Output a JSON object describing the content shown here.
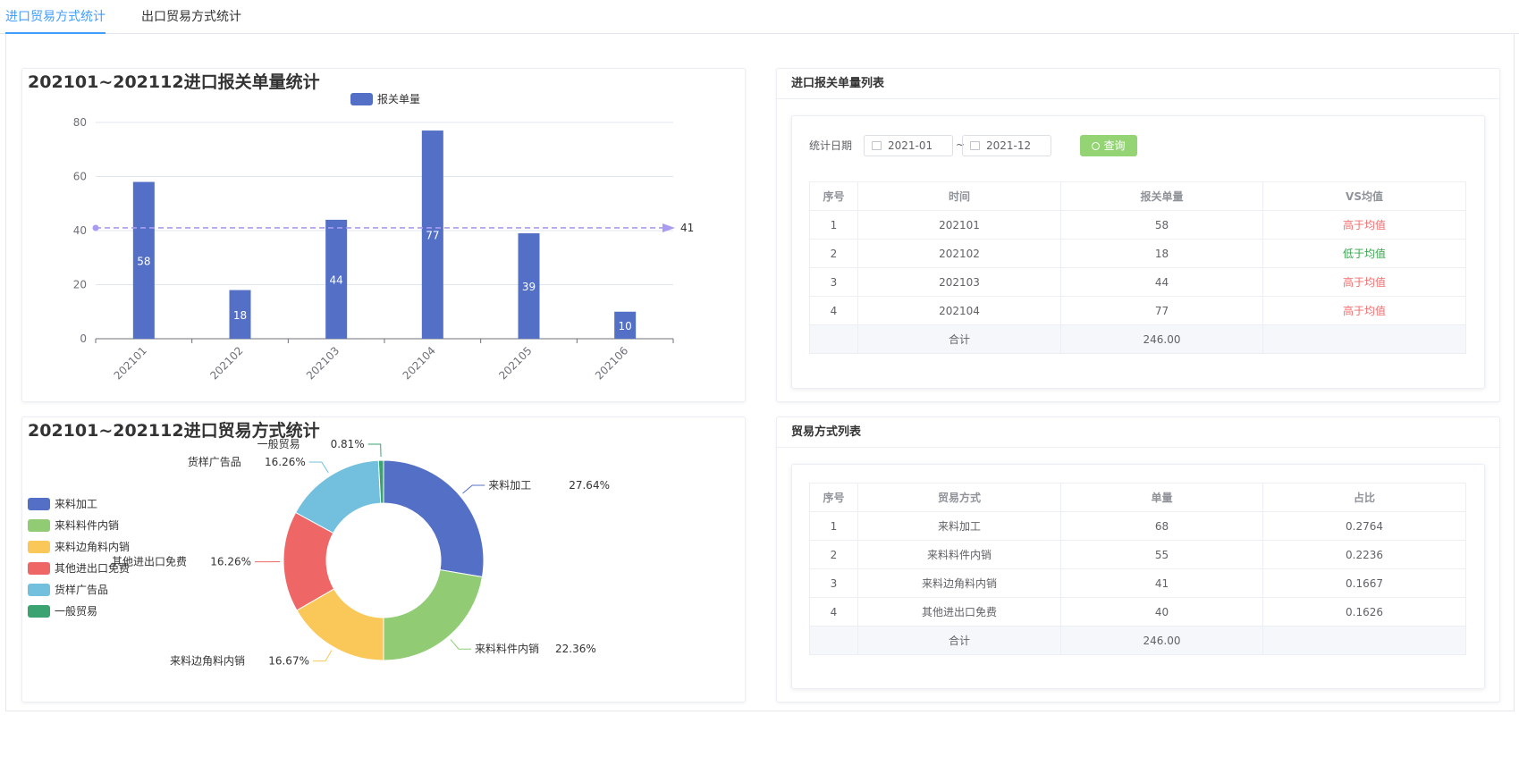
{
  "tabs": [
    {
      "label": "进口贸易方式统计",
      "active": true
    },
    {
      "label": "出口贸易方式统计",
      "active": false
    }
  ],
  "bar_chart": {
    "title": "202101~202112进口报关单量统计"
  },
  "pie_chart": {
    "title": "202101~202112进口贸易方式统计"
  },
  "chart_data": [
    {
      "type": "bar",
      "title": "202101~202112进口报关单量统计",
      "categories": [
        "202101",
        "202102",
        "202103",
        "202104",
        "202105",
        "202106"
      ],
      "series": [
        {
          "name": "报关单量",
          "values": [
            58,
            18,
            44,
            77,
            39,
            10
          ]
        }
      ],
      "ylim": [
        0,
        80
      ],
      "yticks": [
        0,
        20,
        40,
        60,
        80
      ],
      "mark_line": {
        "value": 41,
        "label": "41"
      },
      "legend": "top",
      "color": "#5470c6",
      "grid": true
    },
    {
      "type": "pie",
      "title": "202101~202112进口贸易方式统计",
      "donut": true,
      "legend": "left",
      "slices": [
        {
          "name": "来料加工",
          "value": 27.64,
          "label": "27.64%",
          "color": "#5470c6"
        },
        {
          "name": "来料料件内销",
          "value": 22.36,
          "label": "22.36%",
          "color": "#91cc75"
        },
        {
          "name": "来料边角料内销",
          "value": 16.67,
          "label": "16.67%",
          "color": "#fac858"
        },
        {
          "name": "其他进出口免费",
          "value": 16.26,
          "label": "16.26%",
          "color": "#ee6666"
        },
        {
          "name": "货样广告品",
          "value": 16.26,
          "label": "16.26%",
          "color": "#73c0de"
        },
        {
          "name": "一般贸易",
          "value": 0.81,
          "label": "0.81%",
          "color": "#3ba272"
        }
      ]
    }
  ],
  "customs_panel": {
    "title": "进口报关单量列表",
    "filter_label": "统计日期",
    "start": "2021-01",
    "tilde": "~",
    "end": "2021-12",
    "query": "查询",
    "headers": [
      "序号",
      "时间",
      "报关单量",
      "VS均值"
    ],
    "rows": [
      {
        "idx": "1",
        "time": "202101",
        "count": "58",
        "vs": "高于均值",
        "status": "high"
      },
      {
        "idx": "2",
        "time": "202102",
        "count": "18",
        "vs": "低于均值",
        "status": "low"
      },
      {
        "idx": "3",
        "time": "202103",
        "count": "44",
        "vs": "高于均值",
        "status": "high"
      },
      {
        "idx": "4",
        "time": "202104",
        "count": "77",
        "vs": "高于均值",
        "status": "high"
      }
    ],
    "sum_label": "合计",
    "sum_value": "246.00"
  },
  "trade_panel": {
    "title": "贸易方式列表",
    "headers": [
      "序号",
      "贸易方式",
      "单量",
      "占比"
    ],
    "rows": [
      {
        "idx": "1",
        "mode": "来料加工",
        "count": "68",
        "ratio": "0.2764"
      },
      {
        "idx": "2",
        "mode": "来料料件内销",
        "count": "55",
        "ratio": "0.2236"
      },
      {
        "idx": "3",
        "mode": "来料边角料内销",
        "count": "41",
        "ratio": "0.1667"
      },
      {
        "idx": "4",
        "mode": "其他进出口免费",
        "count": "40",
        "ratio": "0.1626"
      }
    ],
    "sum_label": "合计",
    "sum_value": "246.00"
  },
  "colors": {
    "accent": "#409eff",
    "high": "#f56c6c",
    "low": "#37a64d",
    "query": "#95d475"
  }
}
